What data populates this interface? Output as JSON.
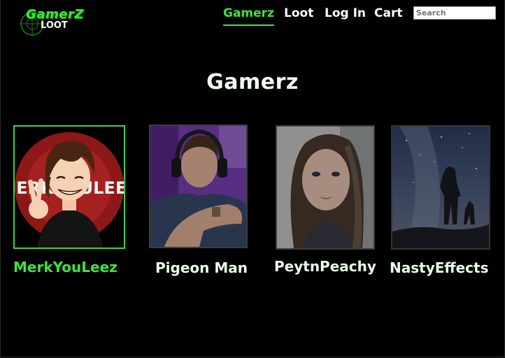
{
  "logo": {
    "top_text": "GamerZ",
    "bottom_text": "LOOT",
    "icon": "crosshair-icon"
  },
  "nav": {
    "items": [
      {
        "label": "Gamerz",
        "active": true
      },
      {
        "label": "Loot"
      },
      {
        "label": "Log In"
      },
      {
        "label": "Cart"
      }
    ]
  },
  "search": {
    "placeholder": "Search"
  },
  "main": {
    "title": "Gamerz",
    "gamers": [
      {
        "name": "MerkYouLeez",
        "selected": true,
        "avatar_text": "MERKYOULEEZ"
      },
      {
        "name": "Pigeon Man"
      },
      {
        "name": "PeytnPeachy"
      },
      {
        "name": "NastyEffects"
      }
    ]
  },
  "colors": {
    "accent": "#3ee43e",
    "background": "#000000",
    "text": "#ffffff"
  }
}
